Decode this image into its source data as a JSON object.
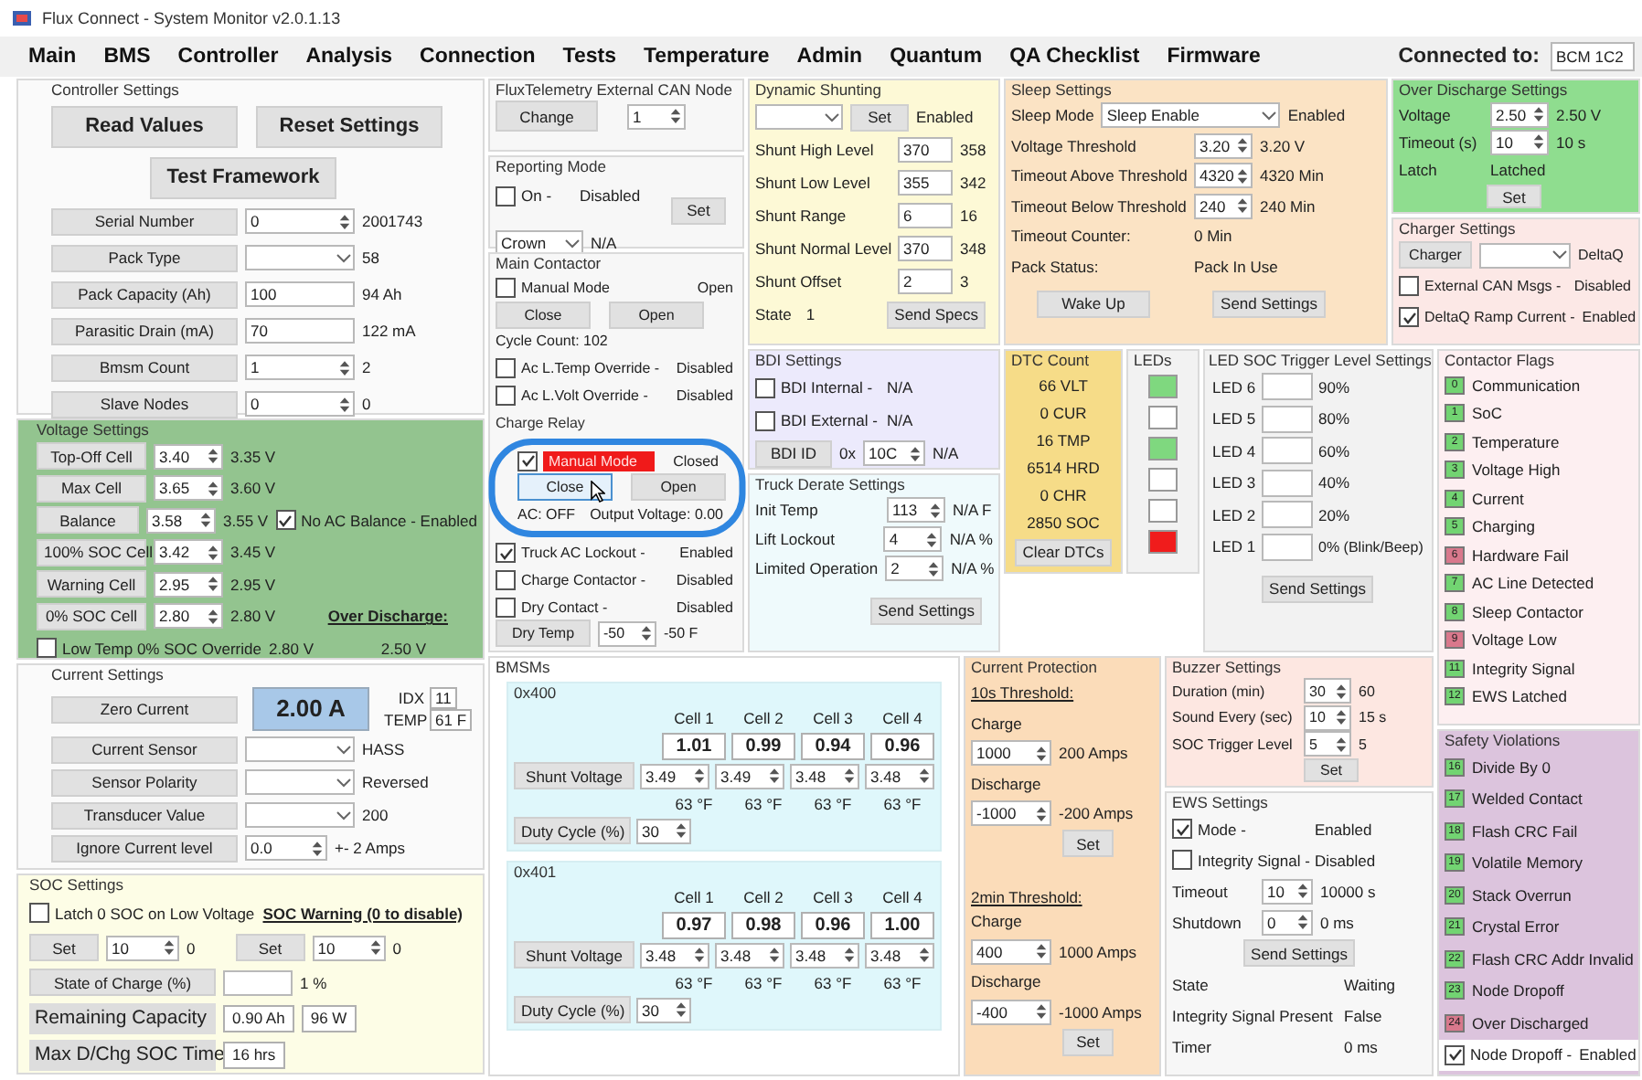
{
  "window": {
    "title": "Flux Connect - System Monitor v2.0.1.13"
  },
  "menu": [
    "Main",
    "BMS",
    "Controller",
    "Analysis",
    "Connection",
    "Tests",
    "Temperature",
    "Admin",
    "Quantum",
    "QA Checklist",
    "Firmware"
  ],
  "connection": {
    "label": "Connected to:",
    "value": "BCM 1C2"
  },
  "controller_settings": {
    "title": "Controller Settings",
    "header": [
      [
        {
          "kind": "button",
          "label": "Read Values"
        },
        {
          "kind": "button",
          "label": "Reset Settings"
        }
      ],
      [
        {
          "kind": "button",
          "label": "Test Framework"
        }
      ]
    ],
    "rows": [
      [
        {
          "kind": "button",
          "label": "Serial Number"
        },
        {
          "kind": "spin",
          "value": "0"
        },
        {
          "kind": "text",
          "text": "2001743"
        }
      ],
      [
        {
          "kind": "button",
          "label": "Pack Type"
        },
        {
          "kind": "combo"
        },
        {
          "kind": "text",
          "text": "58"
        }
      ],
      [
        {
          "kind": "button",
          "label": "Pack Capacity (Ah)"
        },
        {
          "kind": "input",
          "value": "100"
        },
        {
          "kind": "text",
          "text": "94 Ah"
        }
      ],
      [
        {
          "kind": "button",
          "label": "Parasitic Drain (mA)"
        },
        {
          "kind": "input",
          "value": "70"
        },
        {
          "kind": "text",
          "text": "122 mA"
        }
      ],
      [
        {
          "kind": "button",
          "label": "Bmsm Count"
        },
        {
          "kind": "spin",
          "value": "1"
        },
        {
          "kind": "text",
          "text": "2"
        }
      ],
      [
        {
          "kind": "button",
          "label": "Slave Nodes"
        },
        {
          "kind": "spin",
          "value": "0"
        },
        {
          "kind": "text",
          "text": "0"
        }
      ]
    ]
  },
  "external_can_node": {
    "title": "FluxTelemetry External CAN Node",
    "rows": [
      [
        {
          "kind": "button",
          "label": "Change"
        },
        {
          "kind": "spin",
          "value": "1"
        }
      ]
    ]
  },
  "dynamic_shunting": {
    "title": "Dynamic Shunting",
    "rows": [
      [
        {
          "kind": "combo"
        },
        {
          "kind": "button",
          "label": "Set"
        },
        {
          "kind": "text",
          "text": "Enabled"
        }
      ],
      [
        {
          "kind": "label",
          "text": "Shunt High Level"
        },
        {
          "kind": "input",
          "value": "370"
        },
        {
          "kind": "text",
          "text": "358"
        }
      ],
      [
        {
          "kind": "label",
          "text": "Shunt Low Level"
        },
        {
          "kind": "input",
          "value": "355"
        },
        {
          "kind": "text",
          "text": "342"
        }
      ],
      [
        {
          "kind": "label",
          "text": "Shunt Range"
        },
        {
          "kind": "input",
          "value": "6"
        },
        {
          "kind": "text",
          "text": "16"
        }
      ],
      [
        {
          "kind": "label",
          "text": "Shunt Normal Level"
        },
        {
          "kind": "input",
          "value": "370"
        },
        {
          "kind": "text",
          "text": "348"
        }
      ],
      [
        {
          "kind": "label",
          "text": "Shunt Offset"
        },
        {
          "kind": "input",
          "value": "2"
        },
        {
          "kind": "text",
          "text": "3"
        }
      ]
    ],
    "footer": [
      [
        {
          "kind": "text",
          "text": "State"
        },
        {
          "kind": "text",
          "text": "1"
        },
        {
          "kind": "button",
          "label": "Send Specs"
        }
      ]
    ]
  },
  "sleep_settings": {
    "title": "Sleep Settings",
    "rows": [
      [
        {
          "kind": "text",
          "text": "Sleep Mode"
        },
        {
          "kind": "combo",
          "value": "Sleep Enable"
        },
        {
          "kind": "text",
          "text": "Enabled"
        }
      ],
      [
        {
          "kind": "label",
          "text": "Voltage Threshold"
        },
        {
          "kind": "spin",
          "value": "3.20"
        },
        {
          "kind": "text",
          "text": "3.20 V"
        }
      ],
      [
        {
          "kind": "label",
          "text": "Timeout Above Threshold"
        },
        {
          "kind": "spin",
          "value": "4320"
        },
        {
          "kind": "text",
          "text": "4320 Min"
        }
      ],
      [
        {
          "kind": "label",
          "text": "Timeout Below Threshold"
        },
        {
          "kind": "spin",
          "value": "240"
        },
        {
          "kind": "text",
          "text": "240 Min"
        }
      ],
      [
        {
          "kind": "label",
          "text": "Timeout Counter:"
        },
        {
          "kind": "text",
          "text": "0 Min"
        }
      ],
      [
        {
          "kind": "label",
          "text": "Pack Status:"
        },
        {
          "kind": "text",
          "text": "Pack In Use"
        }
      ],
      [
        {
          "kind": "button",
          "label": "Wake Up"
        },
        {
          "kind": "button",
          "label": "Send Settings"
        }
      ]
    ]
  },
  "over_discharge_settings": {
    "title": "Over Discharge Settings",
    "rows": [
      [
        {
          "kind": "label",
          "text": "Voltage"
        },
        {
          "kind": "spin",
          "value": "2.50"
        },
        {
          "kind": "text",
          "text": "2.50 V"
        }
      ],
      [
        {
          "kind": "label",
          "text": "Timeout (s)"
        },
        {
          "kind": "spin",
          "value": "10"
        },
        {
          "kind": "text",
          "text": "10 s"
        }
      ],
      [
        {
          "kind": "label",
          "text": "Latch"
        },
        {
          "kind": "text",
          "text": "Latched"
        }
      ]
    ],
    "footer": [
      [
        {
          "kind": "button",
          "label": "Set"
        }
      ]
    ]
  },
  "reporting_mode": {
    "title": "Reporting Mode",
    "rows": [
      [
        {
          "kind": "stack",
          "rows": [
            [
              {
                "kind": "check",
                "label": "On -",
                "checked": false
              },
              {
                "kind": "text",
                "text": "Disabled"
              }
            ],
            [
              {
                "kind": "combo",
                "value": "Crown"
              },
              {
                "kind": "text",
                "text": "N/A"
              }
            ]
          ]
        },
        {
          "kind": "button",
          "label": "Set"
        }
      ]
    ]
  },
  "main_contactor": {
    "title": "Main Contactor",
    "rows": [
      [
        {
          "kind": "check",
          "label": "Manual Mode",
          "checked": false
        },
        {
          "kind": "text",
          "text": "Open"
        }
      ],
      [
        {
          "kind": "button",
          "label": "Close"
        },
        {
          "kind": "button",
          "label": "Open"
        }
      ],
      [
        {
          "kind": "text",
          "text": "Cycle Count: 102"
        }
      ],
      [
        {
          "kind": "check",
          "label": "Ac L.Temp Override -",
          "checked": false
        },
        {
          "kind": "text",
          "text": "Disabled"
        }
      ],
      [
        {
          "kind": "check",
          "label": "Ac L.Volt Override -",
          "checked": false
        },
        {
          "kind": "text",
          "text": "Disabled"
        }
      ],
      [
        {
          "kind": "subtitle",
          "text": "Charge Relay"
        }
      ],
      [
        {
          "kind": "check",
          "label": "Manual Mode",
          "checked": true,
          "alert": true
        },
        {
          "kind": "text",
          "text": "Closed"
        }
      ],
      [
        {
          "kind": "button",
          "label": "Close",
          "focused": true
        },
        {
          "kind": "button",
          "label": "Open"
        }
      ],
      [
        {
          "kind": "text",
          "text": "AC: OFF"
        },
        {
          "kind": "text",
          "text": "Output Voltage: 0.00"
        }
      ],
      [
        {
          "kind": "check",
          "label": "Truck AC Lockout -",
          "checked": true
        },
        {
          "kind": "text",
          "text": "Enabled"
        }
      ],
      [
        {
          "kind": "check",
          "label": "Charge Contactor -",
          "checked": false
        },
        {
          "kind": "text",
          "text": "Disabled"
        }
      ],
      [
        {
          "kind": "check",
          "label": "Dry Contact -",
          "checked": false
        },
        {
          "kind": "text",
          "text": "Disabled"
        }
      ],
      [
        {
          "kind": "button",
          "label": "Dry Temp"
        },
        {
          "kind": "spin",
          "value": "-50"
        },
        {
          "kind": "text",
          "text": "-50 F"
        }
      ]
    ]
  },
  "bdi_settings": {
    "title": "BDI Settings",
    "rows": [
      [
        {
          "kind": "check",
          "label": "BDI Internal -",
          "checked": false
        },
        {
          "kind": "text",
          "text": "N/A"
        }
      ],
      [
        {
          "kind": "check",
          "label": "BDI External -",
          "checked": false
        },
        {
          "kind": "text",
          "text": "N/A"
        }
      ]
    ],
    "footer": [
      [
        {
          "kind": "button",
          "label": "BDI ID"
        },
        {
          "kind": "text",
          "text": "0x"
        },
        {
          "kind": "spin",
          "value": "10C"
        },
        {
          "kind": "text",
          "text": "N/A"
        }
      ]
    ]
  },
  "charger_settings": {
    "title": "Charger Settings",
    "rows": [
      [
        {
          "kind": "button",
          "label": "Charger"
        },
        {
          "kind": "combo"
        },
        {
          "kind": "text",
          "text": "DeltaQ"
        }
      ],
      [
        {
          "kind": "check",
          "label": "External CAN Msgs -",
          "checked": false
        },
        {
          "kind": "text",
          "text": "Disabled"
        }
      ],
      [
        {
          "kind": "check",
          "label": "DeltaQ Ramp Current -",
          "checked": true
        },
        {
          "kind": "text",
          "text": "Enabled"
        }
      ]
    ]
  },
  "dtc_count": {
    "title": "DTC Count",
    "rows": [
      [
        {
          "kind": "text",
          "text": "66 VLT"
        }
      ],
      [
        {
          "kind": "text",
          "text": "0 CUR"
        }
      ],
      [
        {
          "kind": "text",
          "text": "16 TMP"
        }
      ],
      [
        {
          "kind": "text",
          "text": "6514 HRD"
        }
      ],
      [
        {
          "kind": "text",
          "text": "0 CHR"
        }
      ],
      [
        {
          "kind": "text",
          "text": "2850 SOC"
        }
      ],
      [
        {
          "kind": "button",
          "label": "Clear DTCs"
        }
      ]
    ]
  },
  "leds": {
    "title": "LEDs",
    "rows": [
      [
        {
          "kind": "led",
          "color": "#7fd87f"
        }
      ],
      [
        {
          "kind": "led",
          "color": "#ffffff"
        }
      ],
      [
        {
          "kind": "led",
          "color": "#7fd87f"
        }
      ],
      [
        {
          "kind": "led",
          "color": "#ffffff"
        }
      ],
      [
        {
          "kind": "led",
          "color": "#ffffff"
        }
      ],
      [
        {
          "kind": "led",
          "color": "#f01c1c"
        }
      ]
    ]
  },
  "led_soc_trigger_levels": {
    "title": "LED SOC Trigger Level Settings",
    "rows": [
      [
        {
          "kind": "label",
          "text": "LED 6"
        },
        {
          "kind": "input"
        },
        {
          "kind": "text",
          "text": "90%"
        }
      ],
      [
        {
          "kind": "label",
          "text": "LED 5"
        },
        {
          "kind": "input"
        },
        {
          "kind": "text",
          "text": "80%"
        }
      ],
      [
        {
          "kind": "label",
          "text": "LED 4"
        },
        {
          "kind": "input"
        },
        {
          "kind": "text",
          "text": "60%"
        }
      ],
      [
        {
          "kind": "label",
          "text": "LED 3"
        },
        {
          "kind": "input"
        },
        {
          "kind": "text",
          "text": "40%"
        }
      ],
      [
        {
          "kind": "label",
          "text": "LED 2"
        },
        {
          "kind": "input"
        },
        {
          "kind": "text",
          "text": "20%"
        }
      ],
      [
        {
          "kind": "label",
          "text": "LED 1"
        },
        {
          "kind": "input"
        },
        {
          "kind": "text",
          "text": "0% (Blink/Beep)"
        }
      ]
    ],
    "footer": [
      [
        {
          "kind": "button",
          "label": "Send Settings"
        }
      ]
    ]
  },
  "contactor_flags": {
    "title": "Contactor Flags",
    "rows": [
      [
        {
          "kind": "flag",
          "number": "0",
          "color": "#72d472"
        },
        {
          "kind": "text",
          "text": "Communication"
        }
      ],
      [
        {
          "kind": "flag",
          "number": "1",
          "color": "#72d472"
        },
        {
          "kind": "text",
          "text": "SoC"
        }
      ],
      [
        {
          "kind": "flag",
          "number": "2",
          "color": "#72d472"
        },
        {
          "kind": "text",
          "text": "Temperature"
        }
      ],
      [
        {
          "kind": "flag",
          "number": "3",
          "color": "#72d472"
        },
        {
          "kind": "text",
          "text": "Voltage High"
        }
      ],
      [
        {
          "kind": "flag",
          "number": "4",
          "color": "#72d472"
        },
        {
          "kind": "text",
          "text": "Current"
        }
      ],
      [
        {
          "kind": "flag",
          "number": "5",
          "color": "#72d472"
        },
        {
          "kind": "text",
          "text": "Charging"
        }
      ],
      [
        {
          "kind": "flag",
          "number": "6",
          "color": "#d9788c"
        },
        {
          "kind": "text",
          "text": "Hardware Fail"
        }
      ],
      [
        {
          "kind": "flag",
          "number": "7",
          "color": "#72d472"
        },
        {
          "kind": "text",
          "text": "AC Line Detected"
        }
      ],
      [
        {
          "kind": "flag",
          "number": "8",
          "color": "#72d472"
        },
        {
          "kind": "text",
          "text": "Sleep Contactor"
        }
      ],
      [
        {
          "kind": "flag",
          "number": "9",
          "color": "#d9788c"
        },
        {
          "kind": "text",
          "text": "Voltage Low"
        }
      ],
      [
        {
          "kind": "flag",
          "number": "11",
          "color": "#72d472"
        },
        {
          "kind": "text",
          "text": "Integrity Signal"
        }
      ],
      [
        {
          "kind": "flag",
          "number": "12",
          "color": "#72d472"
        },
        {
          "kind": "text",
          "text": "EWS Latched"
        }
      ]
    ]
  },
  "voltage_settings": {
    "title": "Voltage Settings",
    "rows": [
      [
        {
          "kind": "button",
          "label": "Top-Off Cell"
        },
        {
          "kind": "spin",
          "value": "3.40"
        },
        {
          "kind": "text",
          "text": "3.35 V"
        }
      ],
      [
        {
          "kind": "button",
          "label": "Max Cell"
        },
        {
          "kind": "spin",
          "value": "3.65"
        },
        {
          "kind": "text",
          "text": "3.60 V"
        }
      ],
      [
        {
          "kind": "button",
          "label": "Balance"
        },
        {
          "kind": "spin",
          "value": "3.58"
        },
        {
          "kind": "text",
          "text": "3.55 V"
        },
        {
          "kind": "check",
          "label": "No AC Balance - Enabled",
          "checked": true
        }
      ],
      [
        {
          "kind": "button",
          "label": "100% SOC Cell"
        },
        {
          "kind": "spin",
          "value": "3.42"
        },
        {
          "kind": "text",
          "text": "3.45 V"
        }
      ],
      [
        {
          "kind": "button",
          "label": "Warning Cell"
        },
        {
          "kind": "spin",
          "value": "2.95"
        },
        {
          "kind": "text",
          "text": "2.95 V"
        }
      ],
      [
        {
          "kind": "button",
          "label": "0% SOC Cell"
        },
        {
          "kind": "spin",
          "value": "2.80"
        },
        {
          "kind": "text",
          "text": "2.80 V"
        },
        {
          "kind": "heading",
          "text": "Over Discharge:"
        }
      ]
    ],
    "footer": [
      [
        {
          "kind": "check",
          "label": "Low Temp 0% SOC Override",
          "checked": false
        },
        {
          "kind": "text",
          "text": "2.80 V"
        },
        {
          "kind": "text",
          "text": "2.50 V"
        }
      ]
    ]
  },
  "truck_derate_settings": {
    "title": "Truck Derate Settings",
    "rows": [
      [
        {
          "kind": "label",
          "text": "Init Temp"
        },
        {
          "kind": "spin",
          "value": "113"
        },
        {
          "kind": "text",
          "text": "N/A F"
        }
      ],
      [
        {
          "kind": "label",
          "text": "Lift Lockout"
        },
        {
          "kind": "spin",
          "value": "4"
        },
        {
          "kind": "text",
          "text": "N/A %"
        }
      ],
      [
        {
          "kind": "label",
          "text": "Limited Operation"
        },
        {
          "kind": "spin",
          "value": "2"
        },
        {
          "kind": "text",
          "text": "N/A %"
        }
      ]
    ],
    "footer": [
      [
        {
          "kind": "button",
          "label": "Send Settings"
        }
      ]
    ]
  },
  "current_settings": {
    "title": "Current Settings",
    "rows": [
      [
        {
          "kind": "button",
          "label": "Zero Current"
        },
        {
          "kind": "readout",
          "text": "2.00 A"
        },
        {
          "kind": "stack",
          "rows": [
            [
              {
                "kind": "text",
                "text": "IDX"
              },
              {
                "kind": "boxed",
                "text": "11"
              }
            ],
            [
              {
                "kind": "text",
                "text": "TEMP"
              },
              {
                "kind": "boxed",
                "text": "61 F"
              }
            ]
          ]
        }
      ],
      [
        {
          "kind": "button",
          "label": "Current Sensor"
        },
        {
          "kind": "combo"
        },
        {
          "kind": "text",
          "text": "HASS"
        }
      ],
      [
        {
          "kind": "button",
          "label": "Sensor Polarity"
        },
        {
          "kind": "combo"
        },
        {
          "kind": "text",
          "text": "Reversed"
        }
      ],
      [
        {
          "kind": "button",
          "label": "Transducer Value"
        },
        {
          "kind": "combo"
        },
        {
          "kind": "text",
          "text": "200"
        }
      ],
      [
        {
          "kind": "button",
          "label": "Ignore Current level"
        },
        {
          "kind": "spin",
          "value": "0.0"
        },
        {
          "kind": "text",
          "text": "+- 2 Amps"
        }
      ]
    ]
  },
  "bmsms": {
    "title": "BMSMs",
    "groups": [
      {
        "title": "0x400",
        "rows": [
          [
            {
              "kind": "text",
              "text": "Cell 1"
            },
            {
              "kind": "text",
              "text": "Cell 2"
            },
            {
              "kind": "text",
              "text": "Cell 3"
            },
            {
              "kind": "text",
              "text": "Cell 4"
            }
          ],
          [
            {
              "kind": "boxed",
              "text": "1.01"
            },
            {
              "kind": "boxed",
              "text": "0.99"
            },
            {
              "kind": "boxed",
              "text": "0.94"
            },
            {
              "kind": "boxed",
              "text": "0.96"
            }
          ],
          [
            {
              "kind": "button",
              "label": "Shunt Voltage"
            },
            {
              "kind": "spin",
              "value": "3.49"
            },
            {
              "kind": "spin",
              "value": "3.49"
            },
            {
              "kind": "spin",
              "value": "3.48"
            },
            {
              "kind": "spin",
              "value": "3.48"
            }
          ],
          [
            {
              "kind": "text",
              "text": "63 °F"
            },
            {
              "kind": "text",
              "text": "63 °F"
            },
            {
              "kind": "text",
              "text": "63 °F"
            },
            {
              "kind": "text",
              "text": "63 °F"
            }
          ],
          [
            {
              "kind": "button",
              "label": "Duty Cycle (%)"
            },
            {
              "kind": "spin",
              "value": "30"
            }
          ]
        ]
      },
      {
        "title": "0x401",
        "rows": [
          [
            {
              "kind": "text",
              "text": "Cell 1"
            },
            {
              "kind": "text",
              "text": "Cell 2"
            },
            {
              "kind": "text",
              "text": "Cell 3"
            },
            {
              "kind": "text",
              "text": "Cell 4"
            }
          ],
          [
            {
              "kind": "boxed",
              "text": "0.97"
            },
            {
              "kind": "boxed",
              "text": "0.98"
            },
            {
              "kind": "boxed",
              "text": "0.96"
            },
            {
              "kind": "boxed",
              "text": "1.00"
            }
          ],
          [
            {
              "kind": "button",
              "label": "Shunt Voltage"
            },
            {
              "kind": "spin",
              "value": "3.48"
            },
            {
              "kind": "spin",
              "value": "3.48"
            },
            {
              "kind": "spin",
              "value": "3.48"
            },
            {
              "kind": "spin",
              "value": "3.48"
            }
          ],
          [
            {
              "kind": "text",
              "text": "63 °F"
            },
            {
              "kind": "text",
              "text": "63 °F"
            },
            {
              "kind": "text",
              "text": "63 °F"
            },
            {
              "kind": "text",
              "text": "63 °F"
            }
          ],
          [
            {
              "kind": "button",
              "label": "Duty Cycle (%)"
            },
            {
              "kind": "spin",
              "value": "30"
            }
          ]
        ]
      }
    ]
  },
  "current_protection": {
    "title": "Current Protection",
    "rows": [
      [
        {
          "kind": "heading",
          "text": "10s Threshold:"
        }
      ],
      [
        {
          "kind": "text",
          "text": "Charge"
        }
      ],
      [
        {
          "kind": "spin",
          "value": "1000"
        },
        {
          "kind": "text",
          "text": "200 Amps"
        }
      ],
      [
        {
          "kind": "text",
          "text": "Discharge"
        }
      ],
      [
        {
          "kind": "spin",
          "value": "-1000"
        },
        {
          "kind": "text",
          "text": "-200 Amps"
        }
      ],
      [
        {
          "kind": "button",
          "label": "Set"
        }
      ],
      [
        {
          "kind": "heading",
          "text": "2min Threshold:"
        }
      ],
      [
        {
          "kind": "text",
          "text": "Charge"
        }
      ],
      [
        {
          "kind": "spin",
          "value": "400"
        },
        {
          "kind": "text",
          "text": "1000 Amps"
        }
      ],
      [
        {
          "kind": "text",
          "text": "Discharge"
        }
      ],
      [
        {
          "kind": "spin",
          "value": "-400"
        },
        {
          "kind": "text",
          "text": "-1000 Amps"
        }
      ],
      [
        {
          "kind": "button",
          "label": "Set"
        }
      ]
    ]
  },
  "buzzer_settings": {
    "title": "Buzzer Settings",
    "rows": [
      [
        {
          "kind": "label",
          "text": "Duration (min)"
        },
        {
          "kind": "spin",
          "value": "30"
        },
        {
          "kind": "text",
          "text": "60"
        }
      ],
      [
        {
          "kind": "label",
          "text": "Sound Every (sec)"
        },
        {
          "kind": "spin",
          "value": "10"
        },
        {
          "kind": "text",
          "text": "15 s"
        }
      ],
      [
        {
          "kind": "label",
          "text": "SOC Trigger Level"
        },
        {
          "kind": "spin",
          "value": "5"
        },
        {
          "kind": "text",
          "text": "5"
        }
      ]
    ],
    "footer": [
      [
        {
          "kind": "button",
          "label": "Set"
        }
      ]
    ]
  },
  "safety_violations": {
    "title": "Safety Violations",
    "rows": [
      [
        {
          "kind": "flag",
          "number": "16",
          "color": "#72d472"
        },
        {
          "kind": "text",
          "text": "Divide By 0"
        }
      ],
      [
        {
          "kind": "flag",
          "number": "17",
          "color": "#72d472"
        },
        {
          "kind": "text",
          "text": "Welded Contact"
        }
      ],
      [
        {
          "kind": "flag",
          "number": "18",
          "color": "#72d472"
        },
        {
          "kind": "text",
          "text": "Flash CRC Fail"
        }
      ],
      [
        {
          "kind": "flag",
          "number": "19",
          "color": "#72d472"
        },
        {
          "kind": "text",
          "text": "Volatile Memory"
        }
      ],
      [
        {
          "kind": "flag",
          "number": "20",
          "color": "#72d472"
        },
        {
          "kind": "text",
          "text": "Stack Overrun"
        }
      ],
      [
        {
          "kind": "flag",
          "number": "21",
          "color": "#72d472"
        },
        {
          "kind": "text",
          "text": "Crystal Error"
        }
      ],
      [
        {
          "kind": "flag",
          "number": "22",
          "color": "#72d472"
        },
        {
          "kind": "text",
          "text": "Flash CRC Addr Invalid"
        }
      ],
      [
        {
          "kind": "flag",
          "number": "23",
          "color": "#72d472"
        },
        {
          "kind": "text",
          "text": "Node Dropoff"
        }
      ],
      [
        {
          "kind": "flag",
          "number": "24",
          "color": "#d9788c"
        },
        {
          "kind": "text",
          "text": "Over Discharged"
        }
      ]
    ],
    "footer": [
      [
        {
          "kind": "check",
          "label": "Node Dropoff -",
          "checked": true
        },
        {
          "kind": "text",
          "text": "Enabled"
        }
      ]
    ]
  },
  "ews_settings": {
    "title": "EWS Settings",
    "rows": [
      [
        {
          "kind": "check",
          "label": "Mode -",
          "checked": true
        },
        {
          "kind": "text",
          "text": "Enabled"
        }
      ],
      [
        {
          "kind": "check",
          "label": "Integrity Signal -",
          "checked": false
        },
        {
          "kind": "text",
          "text": "Disabled"
        }
      ],
      [
        {
          "kind": "label",
          "text": "Timeout"
        },
        {
          "kind": "spin",
          "value": "10"
        },
        {
          "kind": "text",
          "text": "10000 s"
        }
      ],
      [
        {
          "kind": "label",
          "text": "Shutdown"
        },
        {
          "kind": "spin",
          "value": "0"
        },
        {
          "kind": "text",
          "text": "0 ms"
        }
      ],
      [
        {
          "kind": "button",
          "label": "Send Settings"
        }
      ],
      [
        {
          "kind": "label",
          "text": "State"
        },
        {
          "kind": "text",
          "text": "Waiting"
        }
      ],
      [
        {
          "kind": "label",
          "text": "Integrity Signal Present"
        },
        {
          "kind": "text",
          "text": "False"
        }
      ],
      [
        {
          "kind": "label",
          "text": "Timer"
        },
        {
          "kind": "text",
          "text": "0 ms"
        }
      ]
    ]
  },
  "soc_settings": {
    "title": "SOC Settings",
    "header": [
      [
        {
          "kind": "check",
          "label": "Latch 0 SOC on Low Voltage",
          "checked": false
        },
        {
          "kind": "heading",
          "text": "SOC Warning (0 to disable)"
        }
      ]
    ],
    "controls": [
      [
        {
          "kind": "button",
          "label": "Set"
        },
        {
          "kind": "spin",
          "value": "10"
        },
        {
          "kind": "text",
          "text": "0"
        },
        {
          "kind": "button",
          "label": "Set"
        },
        {
          "kind": "spin",
          "value": "10"
        },
        {
          "kind": "text",
          "text": "0"
        }
      ]
    ],
    "rows": [
      [
        {
          "kind": "button",
          "label": "State of Charge (%)"
        },
        {
          "kind": "input"
        },
        {
          "kind": "text",
          "text": "1 %"
        }
      ],
      [
        {
          "kind": "tile",
          "text": "Remaining Capacity"
        },
        {
          "kind": "boxed",
          "text": "0.90 Ah"
        },
        {
          "kind": "boxed",
          "text": "96 W"
        }
      ],
      [
        {
          "kind": "tile",
          "text": "Max D/Chg SOC Time"
        },
        {
          "kind": "boxed",
          "text": "16 hrs"
        }
      ]
    ]
  }
}
